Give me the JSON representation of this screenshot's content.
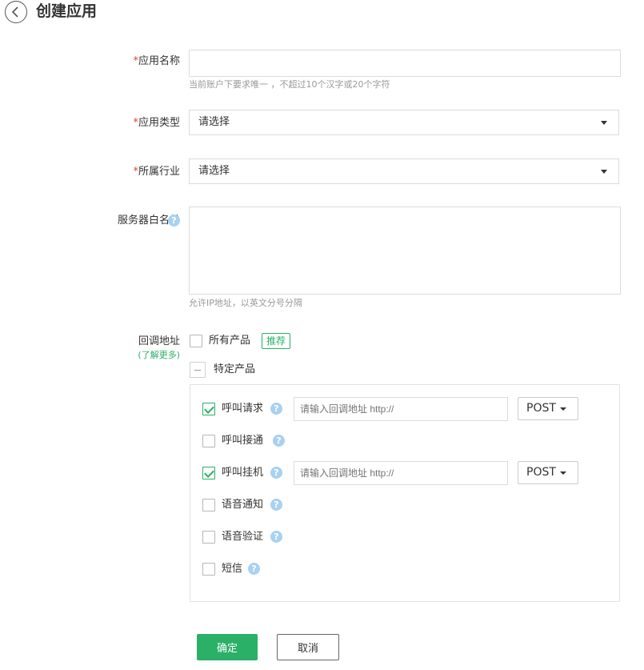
{
  "header": {
    "title": "创建应用",
    "back_icon": "chevron-left-icon"
  },
  "form": {
    "required_mark": "*",
    "app_name": {
      "label": "应用名称",
      "value": "",
      "hint": "当前账户下要求唯一 ，不超过10个汉字或20个字符"
    },
    "app_type": {
      "label": "应用类型",
      "value": "请选择"
    },
    "industry": {
      "label": "所属行业",
      "value": "请选择"
    },
    "whitelist": {
      "label": "服务器白名单",
      "value": "",
      "hint": "允许IP地址，以英文分号分隔",
      "help_icon": "question-icon"
    },
    "callback": {
      "label": "回调地址",
      "learn_more": "(了解更多)",
      "all_products": {
        "label": "所有产品",
        "checked": false,
        "tag": "推荐"
      },
      "specific_products": {
        "label": "特定产品",
        "state": "partial"
      },
      "items": [
        {
          "label": "呼叫请求",
          "checked": true,
          "placeholder": "请输入回调地址 http://",
          "method": "POST"
        },
        {
          "label": "呼叫接通",
          "checked": false
        },
        {
          "label": "呼叫挂机",
          "checked": true,
          "placeholder": "请输入回调地址 http://",
          "method": "POST"
        },
        {
          "label": "语音通知",
          "checked": false
        },
        {
          "label": "语音验证",
          "checked": false
        },
        {
          "label": "短信",
          "checked": false
        }
      ]
    }
  },
  "actions": {
    "confirm": "确定",
    "cancel": "取消"
  },
  "colors": {
    "accent": "#2bb068",
    "required": "#e0433a",
    "help": "#a8d1f2"
  }
}
